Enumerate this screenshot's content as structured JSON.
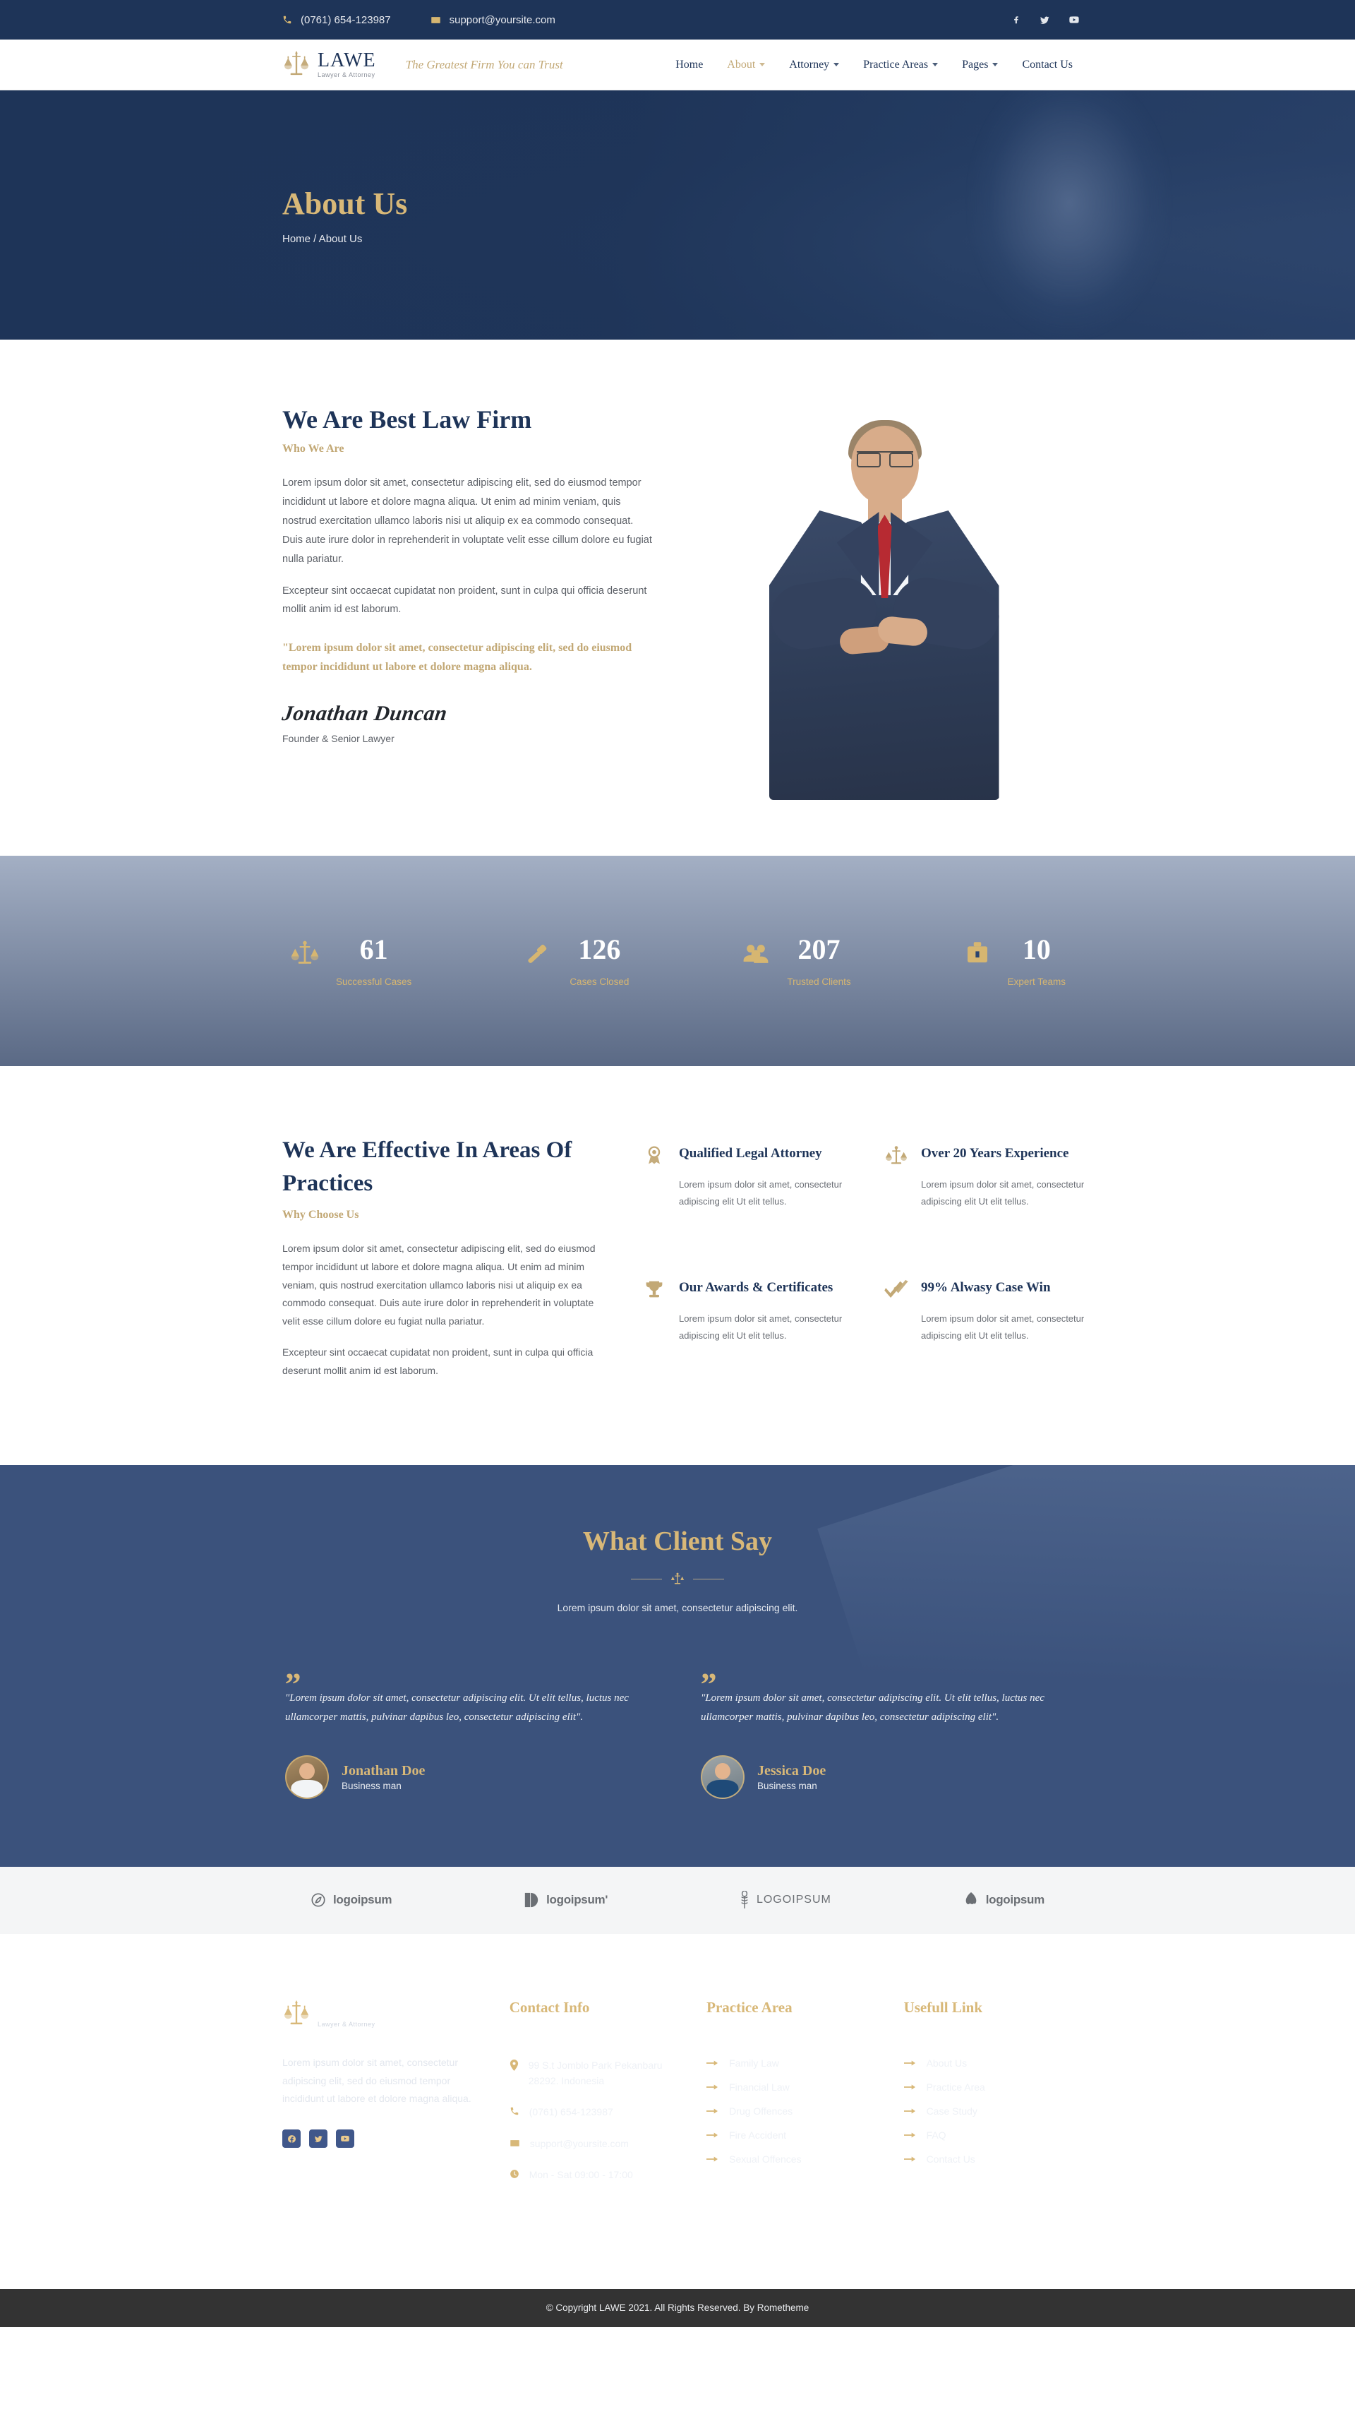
{
  "topbar": {
    "phone": "(0761) 654-123987",
    "email": "support@yoursite.com",
    "socials": [
      "facebook-icon",
      "twitter-icon",
      "youtube-icon"
    ]
  },
  "brand": {
    "name": "LAWE",
    "sub": "Lawyer & Attorney"
  },
  "nav": {
    "tagline": "The Greatest Firm You can Trust",
    "items": [
      {
        "label": "Home",
        "dropdown": false,
        "active": false
      },
      {
        "label": "About",
        "dropdown": true,
        "active": true
      },
      {
        "label": "Attorney",
        "dropdown": true,
        "active": false
      },
      {
        "label": "Practice Areas",
        "dropdown": true,
        "active": false
      },
      {
        "label": "Pages",
        "dropdown": true,
        "active": false
      },
      {
        "label": "Contact Us",
        "dropdown": false,
        "active": false
      }
    ]
  },
  "hero": {
    "title": "About Us",
    "breadcrumb": "Home / About Us"
  },
  "about": {
    "heading": "We Are Best Law Firm",
    "eyebrow": "Who We Are",
    "paragraph1": "Lorem ipsum dolor sit amet, consectetur adipiscing elit, sed do eiusmod tempor incididunt ut labore et dolore magna aliqua. Ut enim ad minim veniam, quis nostrud exercitation ullamco laboris nisi ut aliquip ex ea commodo consequat. Duis aute irure dolor in reprehenderit in voluptate velit esse cillum dolore eu fugiat nulla pariatur.",
    "paragraph2": "Excepteur sint occaecat cupidatat non proident, sunt in culpa qui officia deserunt mollit anim id est laborum.",
    "quote": "\"Lorem ipsum dolor sit amet, consectetur adipiscing elit, sed do eiusmod tempor incididunt ut labore et dolore magna aliqua.",
    "signature": "Jonathan Duncan",
    "role": "Founder & Senior Lawyer"
  },
  "counters": [
    {
      "icon": "scales-icon",
      "value": "61",
      "label": "Successful Cases"
    },
    {
      "icon": "gavel-icon",
      "value": "126",
      "label": "Cases Closed"
    },
    {
      "icon": "users-icon",
      "value": "207",
      "label": "Trusted Clients"
    },
    {
      "icon": "briefcase-icon",
      "value": "10",
      "label": "Expert Teams"
    }
  ],
  "effective": {
    "heading": "We Are Effective In Areas Of Practices",
    "eyebrow": "Why Choose Us",
    "paragraph1": "Lorem ipsum dolor sit amet, consectetur adipiscing elit, sed do eiusmod tempor incididunt ut labore et dolore magna aliqua. Ut enim ad minim veniam, quis nostrud exercitation ullamco laboris nisi ut aliquip ex ea commodo consequat. Duis aute irure dolor in reprehenderit in voluptate velit esse cillum dolore eu fugiat nulla pariatur.",
    "paragraph2": "Excepteur sint occaecat cupidatat non proident, sunt in culpa qui officia deserunt mollit anim id est laborum.",
    "features": [
      {
        "icon": "badge-icon",
        "title": "Qualified Legal Attorney",
        "text": "Lorem ipsum dolor sit amet, consectetur adipiscing elit Ut elit tellus."
      },
      {
        "icon": "scales-icon",
        "title": "Over 20 Years Experience",
        "text": "Lorem ipsum dolor sit amet, consectetur adipiscing elit Ut elit tellus."
      },
      {
        "icon": "trophy-icon",
        "title": "Our Awards & Certificates",
        "text": "Lorem ipsum dolor sit amet, consectetur adipiscing elit Ut elit tellus."
      },
      {
        "icon": "double-check-icon",
        "title": "99% Alwasy Case Win",
        "text": "Lorem ipsum dolor sit amet, consectetur adipiscing elit Ut elit tellus."
      }
    ]
  },
  "testimonials": {
    "heading": "What Client Say",
    "subtitle": "Lorem ipsum dolor sit amet, consectetur adipiscing elit.",
    "items": [
      {
        "quote": "\"Lorem ipsum dolor sit amet, consectetur adipiscing elit. Ut elit tellus, luctus nec ullamcorper mattis, pulvinar dapibus leo, consectetur adipiscing elit\".",
        "name": "Jonathan Doe",
        "role": "Business man"
      },
      {
        "quote": "\"Lorem ipsum dolor sit amet, consectetur adipiscing elit. Ut elit tellus, luctus nec ullamcorper mattis, pulvinar dapibus leo, consectetur adipiscing elit\".",
        "name": "Jessica Doe",
        "role": "Business man"
      }
    ]
  },
  "logos": [
    {
      "name": "logoipsum",
      "mark": "leaf-circle-icon"
    },
    {
      "name": "logoipsum'",
      "mark": "split-circle-icon"
    },
    {
      "name": "LOGOIPSUM",
      "mark": "wheat-icon"
    },
    {
      "name": "logoipsum",
      "mark": "egg-wave-icon"
    }
  ],
  "footer": {
    "about_text": "Lorem ipsum dolor sit amet, consectetur adipiscing elit, sed do eiusmod tempor incididunt ut labore et dolore magna aliqua.",
    "socials": [
      "facebook-icon",
      "twitter-icon",
      "youtube-icon"
    ],
    "contact": {
      "title": "Contact Info",
      "items": [
        {
          "icon": "map-pin-icon",
          "text": "99 S.t Jomblo Park Pekanbaru 28292. Indonesia"
        },
        {
          "icon": "phone-icon",
          "text": "(0761) 654-123987"
        },
        {
          "icon": "envelope-icon",
          "text": "support@yoursite.com"
        },
        {
          "icon": "clock-icon",
          "text": "Mon - Sat 09:00 - 17:00"
        }
      ]
    },
    "practice": {
      "title": "Practice Area",
      "items": [
        "Family Law",
        "Financial Law",
        "Drug Offences",
        "Fire Accident",
        "Sexual Offences"
      ]
    },
    "useful": {
      "title": "Usefull Link",
      "items": [
        "About Us",
        "Practice Area",
        "Case Study",
        "FAQ",
        "Contact Us"
      ]
    },
    "copyright": "© Copyright LAWE 2021. All Rights Reserved. By Rometheme"
  },
  "colors": {
    "navy": "#1e3458",
    "gold": "#c2a875",
    "gold_light": "#d8b878",
    "dark": "#333333"
  }
}
